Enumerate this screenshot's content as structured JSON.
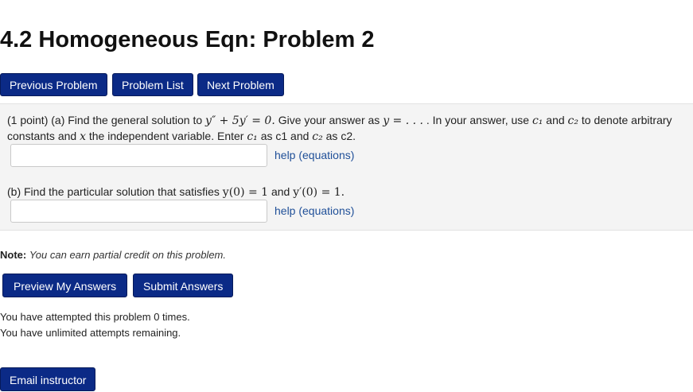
{
  "page": {
    "title": "4.2 Homogeneous Eqn: Problem 2"
  },
  "nav": {
    "previous": "Previous Problem",
    "list": "Problem List",
    "next": "Next Problem"
  },
  "problem": {
    "part_a": {
      "prefix": "(1 point) (a) Find the general solution to",
      "equation": "y″ + 5y′ = 0.",
      "mid": "Give your answer as",
      "answer_form": "y = . . .",
      "after": ". In your answer, use",
      "c1": "c₁",
      "and_word": "and",
      "c2": "c₂",
      "tail": "to denote arbitrary",
      "line2_start": "constants and",
      "x_var": "x",
      "line2_mid": "the independent variable. Enter",
      "as_c1": "as c1 and",
      "as_c2": "as c2.",
      "input_value": "",
      "help": "help (equations)"
    },
    "part_b": {
      "prefix": "(b) Find the particular solution that satisfies",
      "cond1": "y(0) = 1",
      "and_word": "and",
      "cond2": "y′(0) = 1.",
      "input_value": "",
      "help": "help (equations)"
    }
  },
  "note": {
    "label": "Note:",
    "text": "You can earn partial credit on this problem."
  },
  "actions": {
    "preview": "Preview My Answers",
    "submit": "Submit Answers"
  },
  "attempts": {
    "line1": "You have attempted this problem 0 times.",
    "line2": "You have unlimited attempts remaining."
  },
  "footer": {
    "email": "Email instructor"
  },
  "colors": {
    "button_bg": "#0b2a86",
    "link": "#1f4f98",
    "panel_bg": "#f4f4f4"
  }
}
